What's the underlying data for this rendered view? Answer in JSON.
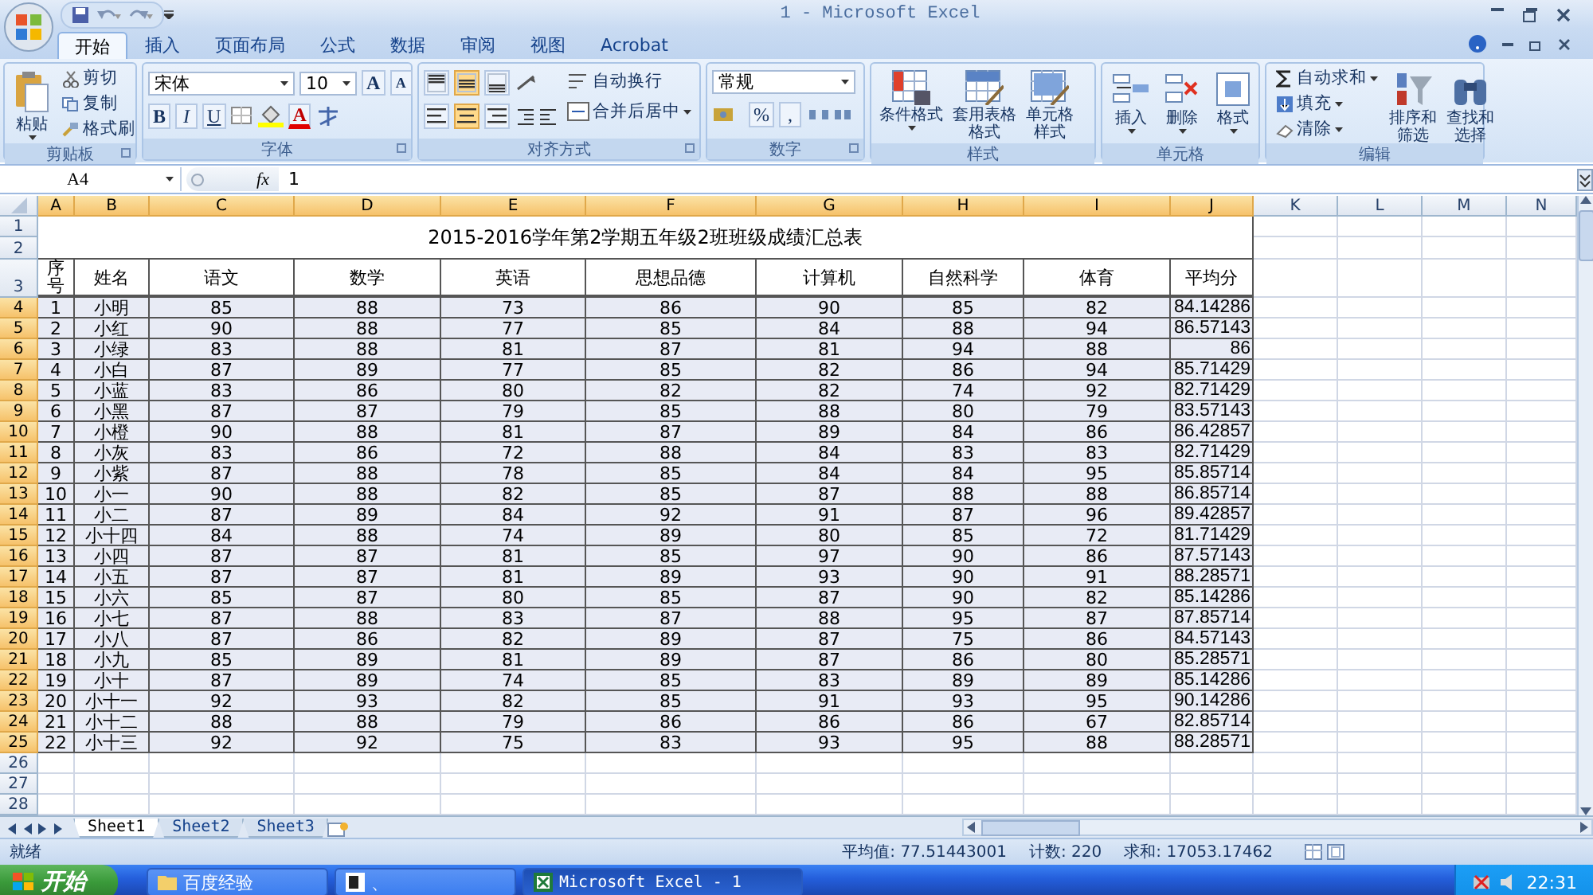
{
  "window": {
    "title": "1 - Microsoft Excel"
  },
  "ribbon_tabs": [
    {
      "label": "开始",
      "selected": true
    },
    {
      "label": "插入",
      "selected": false
    },
    {
      "label": "页面布局",
      "selected": false
    },
    {
      "label": "公式",
      "selected": false
    },
    {
      "label": "数据",
      "selected": false
    },
    {
      "label": "审阅",
      "selected": false
    },
    {
      "label": "视图",
      "selected": false
    },
    {
      "label": "Acrobat",
      "selected": false
    }
  ],
  "ribbon_groups": [
    {
      "kind": "clipboard",
      "label": "剪贴板",
      "large": [
        "粘贴"
      ],
      "small": [
        "剪切",
        "复制",
        "格式刷"
      ]
    },
    {
      "kind": "font",
      "label": "字体",
      "font_name": "宋体",
      "font_size": "10",
      "grow": "A",
      "shrink": "A",
      "styles": [
        "B",
        "I",
        "U"
      ],
      "font_color": "A"
    },
    {
      "kind": "alignment",
      "label": "对齐方式",
      "vertical_align": [
        {
          "selected": false
        },
        {
          "selected": true
        },
        {
          "selected": false
        }
      ],
      "horizontal_align": [
        {
          "selected": false
        },
        {
          "selected": true
        },
        {
          "selected": false
        }
      ],
      "small": [
        "自动换行",
        "合并后居中"
      ]
    },
    {
      "kind": "number",
      "label": "数字",
      "format": "常规",
      "symbols": [
        "%",
        ","
      ]
    },
    {
      "kind": "large",
      "label": "样式",
      "large": [
        "条件格式",
        "套用表格格式",
        "单元格样式"
      ]
    },
    {
      "kind": "large",
      "label": "单元格",
      "large": [
        "插入",
        "删除",
        "格式"
      ]
    },
    {
      "kind": "editing",
      "label": "编辑",
      "small": [
        "自动求和",
        "填充",
        "清除"
      ],
      "large": [
        "排序和筛选",
        "查找和选择"
      ]
    }
  ],
  "formula_bar": {
    "name_box": "A4",
    "fx": "fx",
    "value": "1"
  },
  "sheet": {
    "columns": [
      {
        "label": "A",
        "selected": true
      },
      {
        "label": "B",
        "selected": true
      },
      {
        "label": "C",
        "selected": true
      },
      {
        "label": "D",
        "selected": true
      },
      {
        "label": "E",
        "selected": true
      },
      {
        "label": "F",
        "selected": true
      },
      {
        "label": "G",
        "selected": true
      },
      {
        "label": "H",
        "selected": true
      },
      {
        "label": "I",
        "selected": true
      },
      {
        "label": "J",
        "selected": true
      },
      {
        "label": "K",
        "selected": false
      },
      {
        "label": "L",
        "selected": false
      },
      {
        "label": "M",
        "selected": false
      },
      {
        "label": "N",
        "selected": false
      }
    ],
    "row_numbers": [
      {
        "label": "1",
        "selected": false
      },
      {
        "label": "2",
        "selected": false
      },
      {
        "label": "3",
        "selected": false
      },
      {
        "label": "4",
        "selected": true
      },
      {
        "label": "5",
        "selected": true
      },
      {
        "label": "6",
        "selected": true
      },
      {
        "label": "7",
        "selected": true
      },
      {
        "label": "8",
        "selected": true
      },
      {
        "label": "9",
        "selected": true
      },
      {
        "label": "10",
        "selected": true
      },
      {
        "label": "11",
        "selected": true
      },
      {
        "label": "12",
        "selected": true
      },
      {
        "label": "13",
        "selected": true
      },
      {
        "label": "14",
        "selected": true
      },
      {
        "label": "15",
        "selected": true
      },
      {
        "label": "16",
        "selected": true
      },
      {
        "label": "17",
        "selected": true
      },
      {
        "label": "18",
        "selected": true
      },
      {
        "label": "19",
        "selected": true
      },
      {
        "label": "20",
        "selected": true
      },
      {
        "label": "21",
        "selected": true
      },
      {
        "label": "22",
        "selected": true
      },
      {
        "label": "23",
        "selected": true
      },
      {
        "label": "24",
        "selected": true
      },
      {
        "label": "25",
        "selected": true
      },
      {
        "label": "26",
        "selected": false
      },
      {
        "label": "27",
        "selected": false
      },
      {
        "label": "28",
        "selected": false
      }
    ],
    "title": "2015-2016学年第2学期五年级2班班级成绩汇总表",
    "header": [
      "序号",
      "姓名",
      "语文",
      "数学",
      "英语",
      "思想品德",
      "计算机",
      "自然科学",
      "体育",
      "平均分"
    ],
    "rows": [
      [
        "1",
        "小明",
        "85",
        "88",
        "73",
        "86",
        "90",
        "85",
        "82",
        "84.14286"
      ],
      [
        "2",
        "小红",
        "90",
        "88",
        "77",
        "85",
        "84",
        "88",
        "94",
        "86.57143"
      ],
      [
        "3",
        "小绿",
        "83",
        "88",
        "81",
        "87",
        "81",
        "94",
        "88",
        "86"
      ],
      [
        "4",
        "小白",
        "87",
        "89",
        "77",
        "85",
        "82",
        "86",
        "94",
        "85.71429"
      ],
      [
        "5",
        "小蓝",
        "83",
        "86",
        "80",
        "82",
        "82",
        "74",
        "92",
        "82.71429"
      ],
      [
        "6",
        "小黑",
        "87",
        "87",
        "79",
        "85",
        "88",
        "80",
        "79",
        "83.57143"
      ],
      [
        "7",
        "小橙",
        "90",
        "88",
        "81",
        "87",
        "89",
        "84",
        "86",
        "86.42857"
      ],
      [
        "8",
        "小灰",
        "83",
        "86",
        "72",
        "88",
        "84",
        "83",
        "83",
        "82.71429"
      ],
      [
        "9",
        "小紫",
        "87",
        "88",
        "78",
        "85",
        "84",
        "84",
        "95",
        "85.85714"
      ],
      [
        "10",
        "小一",
        "90",
        "88",
        "82",
        "85",
        "87",
        "88",
        "88",
        "86.85714"
      ],
      [
        "11",
        "小二",
        "87",
        "89",
        "84",
        "92",
        "91",
        "87",
        "96",
        "89.42857"
      ],
      [
        "12",
        "小十四",
        "84",
        "88",
        "74",
        "89",
        "80",
        "85",
        "72",
        "81.71429"
      ],
      [
        "13",
        "小四",
        "87",
        "87",
        "81",
        "85",
        "97",
        "90",
        "86",
        "87.57143"
      ],
      [
        "14",
        "小五",
        "87",
        "87",
        "81",
        "89",
        "93",
        "90",
        "91",
        "88.28571"
      ],
      [
        "15",
        "小六",
        "85",
        "87",
        "80",
        "85",
        "87",
        "90",
        "82",
        "85.14286"
      ],
      [
        "16",
        "小七",
        "87",
        "88",
        "83",
        "87",
        "88",
        "95",
        "87",
        "87.85714"
      ],
      [
        "17",
        "小八",
        "87",
        "86",
        "82",
        "89",
        "87",
        "75",
        "86",
        "84.57143"
      ],
      [
        "18",
        "小九",
        "85",
        "89",
        "81",
        "89",
        "87",
        "86",
        "80",
        "85.28571"
      ],
      [
        "19",
        "小十",
        "87",
        "89",
        "74",
        "85",
        "83",
        "89",
        "89",
        "85.14286"
      ],
      [
        "20",
        "小十一",
        "92",
        "93",
        "82",
        "85",
        "91",
        "93",
        "95",
        "90.14286"
      ],
      [
        "21",
        "小十二",
        "88",
        "88",
        "79",
        "86",
        "86",
        "86",
        "67",
        "82.85714"
      ],
      [
        "22",
        "小十三",
        "92",
        "92",
        "75",
        "83",
        "93",
        "95",
        "88",
        "88.28571"
      ]
    ]
  },
  "sheet_tabs": [
    {
      "label": "Sheet1",
      "selected": true
    },
    {
      "label": "Sheet2",
      "selected": false
    },
    {
      "label": "Sheet3",
      "selected": false
    }
  ],
  "status_bar": {
    "mode": "就绪",
    "average": "平均值: 77.51443001",
    "count": "计数: 220",
    "sum": "求和: 17053.17462"
  },
  "taskbar": {
    "start": "开始",
    "items": [
      {
        "label": "百度经验",
        "selected": false
      },
      {
        "label": "、",
        "selected": false
      },
      {
        "label": "Microsoft Excel - 1",
        "selected": true
      }
    ],
    "clock": "22:31"
  }
}
